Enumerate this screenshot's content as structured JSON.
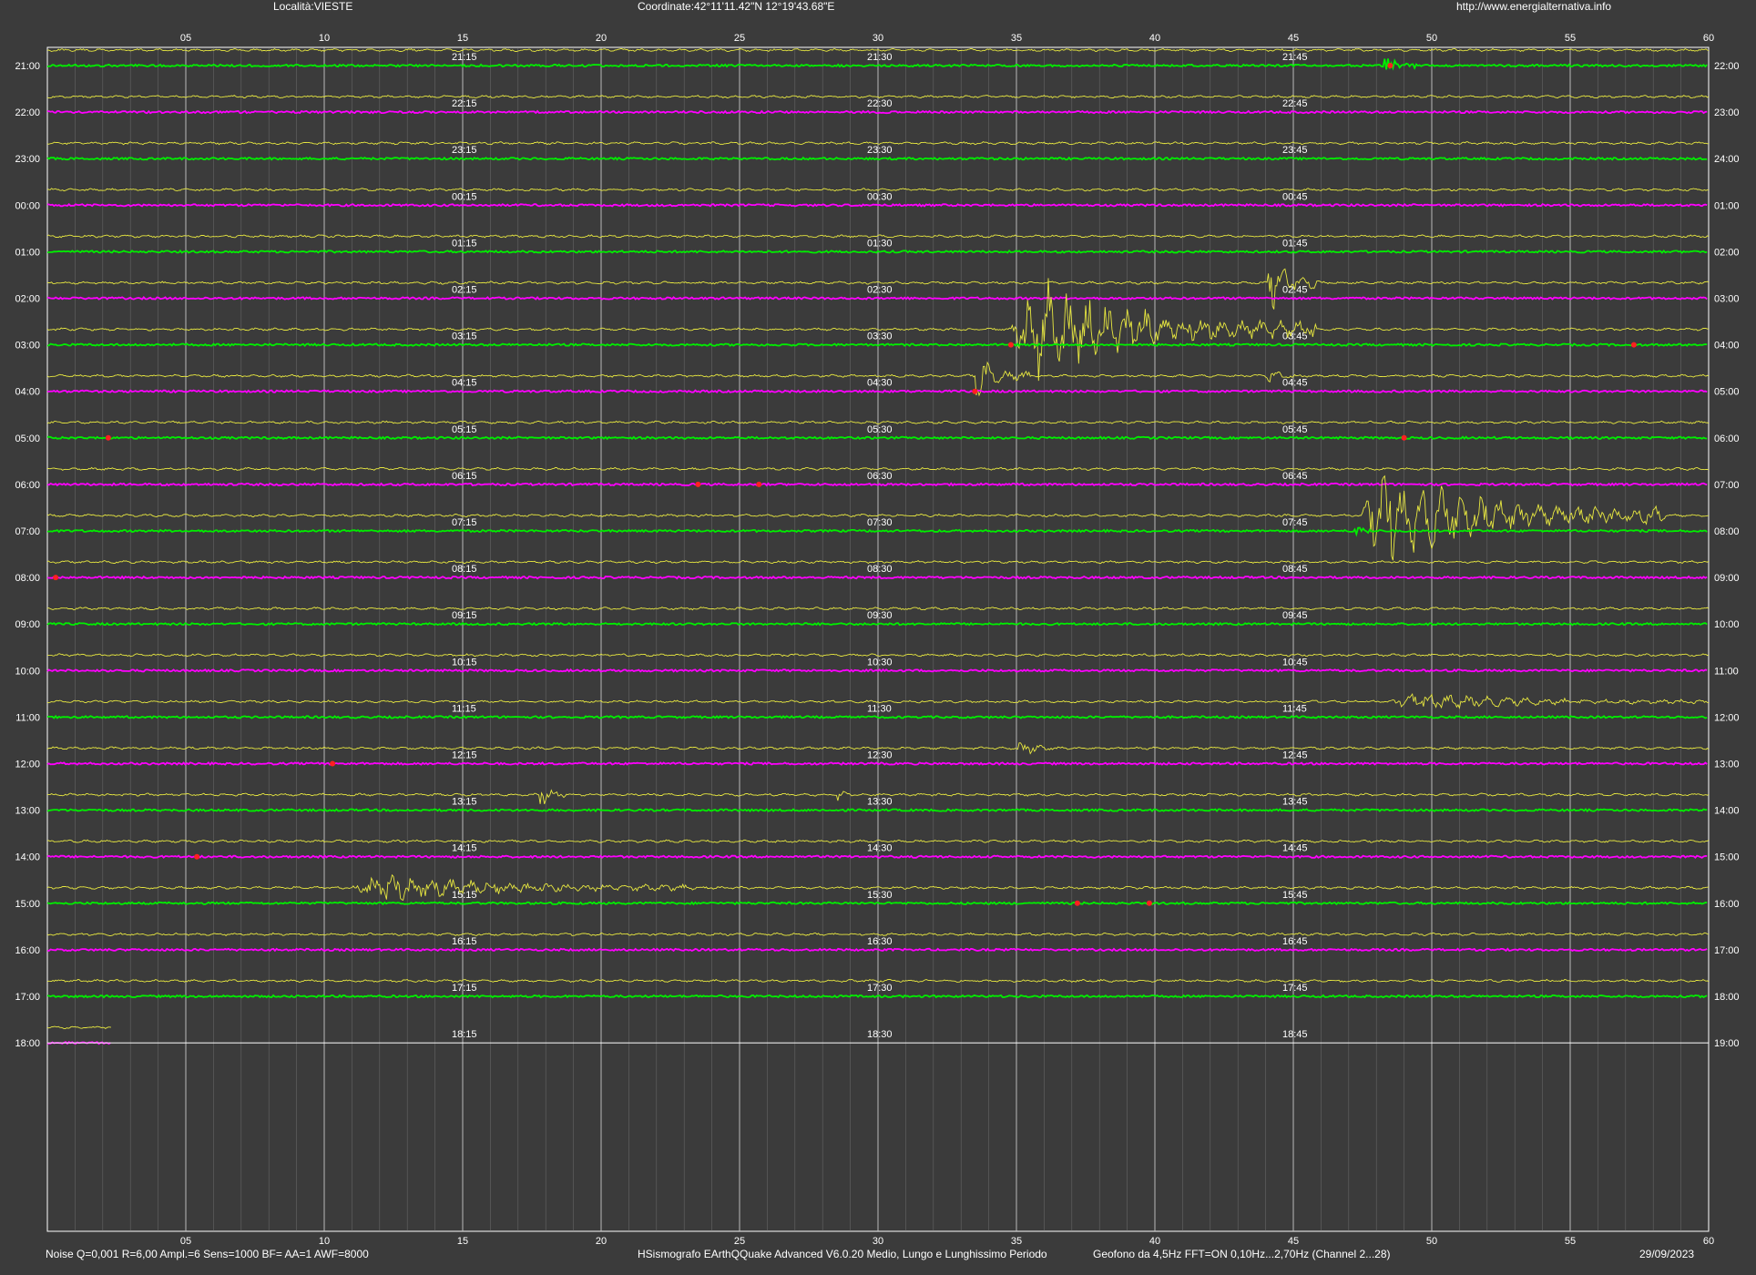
{
  "header": {
    "location": "Località:VIESTE",
    "coordinates": "Coordinate:42°11'11.42\"N  12°19'43.68\"E",
    "website": "http://www.energialternativa.info"
  },
  "footer": {
    "params": "Noise Q=0,001 R=6,00 Ampl.=6 Sens=1000 BF= AA=1 AWF=8000",
    "software": "HSismografo  EArthQQuake Advanced V6.0.20  Medio, Lungo e Lunghissimo Periodo",
    "sensor": "Geofono da 4,5Hz FFT=ON 0,10Hz...2,70Hz      (Channel 2...28)",
    "date": "29/09/2023"
  },
  "colors": {
    "background": "#3b3b3b",
    "grid": "#8a8a8a",
    "frame": "#ffffff",
    "trace_yellow": "#e8e840",
    "trace_green": "#00ee00",
    "trace_magenta": "#ff00ff",
    "marker_red": "#ff2020",
    "text": "#ffffff"
  },
  "chart_data": {
    "type": "line",
    "x_axis": {
      "label": "",
      "range": [
        0,
        60
      ],
      "ticks": [
        "05",
        "10",
        "15",
        "20",
        "25",
        "30",
        "35",
        "40",
        "45",
        "50",
        "55",
        "60"
      ],
      "minor_tick_step": 1,
      "major_tick_step": 5
    },
    "left_hour_labels": [
      "21:00",
      "22:00",
      "23:00",
      "00:00",
      "01:00",
      "02:00",
      "03:00",
      "04:00",
      "05:00",
      "06:00",
      "07:00",
      "08:00",
      "09:00",
      "10:00",
      "11:00",
      "12:00",
      "13:00",
      "14:00",
      "15:00",
      "16:00",
      "17:00",
      "18:00"
    ],
    "right_hour_labels": [
      "22:00",
      "23:00",
      "24:00",
      "01:00",
      "02:00",
      "03:00",
      "04:00",
      "05:00",
      "06:00",
      "07:00",
      "08:00",
      "09:00",
      "10:00",
      "11:00",
      "12:00",
      "13:00",
      "14:00",
      "15:00",
      "16:00",
      "17:00",
      "18:00",
      "19:00"
    ],
    "quarter_labels": [
      [
        "21:15",
        "21:30",
        "21:45"
      ],
      [
        "22:15",
        "22:30",
        "22:45"
      ],
      [
        "23:15",
        "23:30",
        "23:45"
      ],
      [
        "00:15",
        "00:30",
        "00:45"
      ],
      [
        "01:15",
        "01:30",
        "01:45"
      ],
      [
        "02:15",
        "02:30",
        "02:45"
      ],
      [
        "03:15",
        "03:30",
        "03:45"
      ],
      [
        "04:15",
        "04:30",
        "04:45"
      ],
      [
        "05:15",
        "05:30",
        "05:45"
      ],
      [
        "06:15",
        "06:30",
        "06:45"
      ],
      [
        "07:15",
        "07:30",
        "07:45"
      ],
      [
        "08:15",
        "08:30",
        "08:45"
      ],
      [
        "09:15",
        "09:30",
        "09:45"
      ],
      [
        "10:15",
        "10:30",
        "10:45"
      ],
      [
        "11:15",
        "11:30",
        "11:45"
      ],
      [
        "12:15",
        "12:30",
        "12:45"
      ],
      [
        "13:15",
        "13:30",
        "13:45"
      ],
      [
        "14:15",
        "14:30",
        "14:45"
      ],
      [
        "15:15",
        "15:30",
        "15:45"
      ],
      [
        "16:15",
        "16:30",
        "16:45"
      ],
      [
        "17:15",
        "17:30",
        "17:45"
      ],
      [
        "18:15",
        "18:30",
        "18:45"
      ]
    ],
    "main_trace_colors": [
      "green",
      "magenta",
      "green",
      "magenta",
      "green",
      "magenta",
      "green",
      "magenta",
      "green",
      "magenta",
      "green",
      "magenta",
      "green",
      "magenta",
      "green",
      "magenta",
      "green",
      "magenta",
      "green",
      "magenta",
      "green",
      "magenta"
    ],
    "rows_recorded_until_minute": {
      "21": 2.3
    },
    "events": [
      {
        "row": 5,
        "start_min": 44.0,
        "end_min": 46.0,
        "peak": 30,
        "trace": "yellow"
      },
      {
        "row": 6,
        "start_min": 34.8,
        "end_min": 45.8,
        "peak": 55,
        "trace": "yellow"
      },
      {
        "row": 7,
        "start_min": 33.4,
        "end_min": 35.5,
        "peak": 22,
        "trace": "yellow"
      },
      {
        "row": 7,
        "start_min": 44.0,
        "end_min": 45.0,
        "peak": 12,
        "trace": "yellow"
      },
      {
        "row": 10,
        "start_min": 47.4,
        "end_min": 58.4,
        "peak": 50,
        "trace": "yellow"
      },
      {
        "row": 14,
        "start_min": 48.5,
        "end_min": 60.0,
        "peak": 8,
        "trace": "yellow"
      },
      {
        "row": 15,
        "start_min": 35.0,
        "end_min": 36.5,
        "peak": 10,
        "trace": "yellow"
      },
      {
        "row": 16,
        "start_min": 17.7,
        "end_min": 18.8,
        "peak": 14,
        "trace": "yellow"
      },
      {
        "row": 16,
        "start_min": 28.5,
        "end_min": 29.0,
        "peak": 8,
        "trace": "yellow"
      },
      {
        "row": 18,
        "start_min": 11.0,
        "end_min": 23.5,
        "peak": 14,
        "trace": "yellow"
      },
      {
        "row": 0,
        "start_min": 48.2,
        "end_min": 49.5,
        "peak": 14,
        "trace": "green"
      },
      {
        "row": 10,
        "start_min": 47.2,
        "end_min": 47.8,
        "peak": 14,
        "trace": "green"
      }
    ],
    "red_markers": [
      {
        "row": 0,
        "minute": 48.5
      },
      {
        "row": 6,
        "minute": 34.8
      },
      {
        "row": 6,
        "minute": 57.3
      },
      {
        "row": 7,
        "minute": 33.5
      },
      {
        "row": 8,
        "minute": 2.2
      },
      {
        "row": 8,
        "minute": 49.0
      },
      {
        "row": 9,
        "minute": 23.5
      },
      {
        "row": 9,
        "minute": 25.7
      },
      {
        "row": 11,
        "minute": 0.3
      },
      {
        "row": 15,
        "minute": 10.3
      },
      {
        "row": 17,
        "minute": 5.4
      },
      {
        "row": 18,
        "minute": 37.2
      },
      {
        "row": 18,
        "minute": 39.8
      }
    ]
  }
}
